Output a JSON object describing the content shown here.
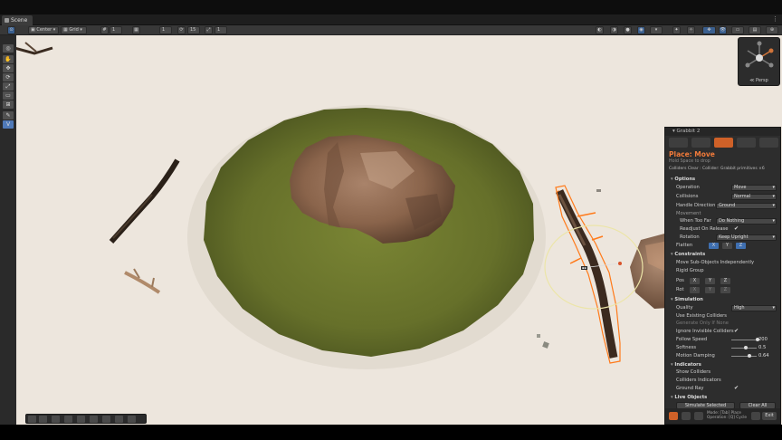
{
  "tab": {
    "label": "Scene"
  },
  "toolbar": {
    "pivot_label": "Center",
    "space_label": "Grid",
    "snap1": "1",
    "snap2": "1",
    "snap3": "15",
    "snap4": "1"
  },
  "gizmo": {
    "label": "≪ Persp"
  },
  "panel": {
    "header": "Grabbit 2",
    "title": "Place: Move",
    "subtitle": "Hold Space to drop",
    "info": "Colliders Clear : Collider: Grabbit primitives ×6",
    "sections": {
      "options": "Options",
      "constraints": "Constraints",
      "simulation": "Simulation",
      "indicators": "Indicators",
      "live_objects": "Live Objects"
    },
    "operation": {
      "label": "Operation",
      "value": "Move"
    },
    "collisions": {
      "label": "Collisions",
      "value": "Normal"
    },
    "handle_direction": {
      "label": "Handle Direction",
      "value": "Ground"
    },
    "movement_label": "Movement",
    "when_too_far": {
      "label": "When Too Far",
      "value": "Do Nothing"
    },
    "readjust": {
      "label": "Readjust On Release",
      "check": "✔"
    },
    "rotation": {
      "label": "Rotation",
      "value": "Keep Upright"
    },
    "flatten": {
      "label": "Flatten",
      "x": "X",
      "y": "Y",
      "z": "Z"
    },
    "move_sub": "Move Sub-Objects Independently",
    "rigid_group": "Rigid Group",
    "pos": {
      "label": "Pos",
      "x": "X",
      "y": "Y",
      "z": "Z"
    },
    "rot": {
      "label": "Rot",
      "x": "X",
      "y": "Y",
      "z": "Z"
    },
    "quality": {
      "label": "Quality",
      "value": "High"
    },
    "use_existing": "Use Existing Colliders",
    "generate_only": "Generate Only If None",
    "ignore_invisible": {
      "label": "Ignore Invisible Colliders",
      "check": "✔"
    },
    "follow_speed": {
      "label": "Follow Speed",
      "value": "200",
      "level": 0.95
    },
    "softness": {
      "label": "Softness",
      "value": "0.5",
      "level": 0.5
    },
    "motion_damping": {
      "label": "Motion Damping",
      "value": "0.64",
      "level": 0.64
    },
    "show_colliders": "Show Colliders",
    "colliders_indicators": "Colliders Indicators",
    "ground_ray": {
      "label": "Ground Ray",
      "check": "✔"
    },
    "simulate_selected": "Simulate Selected",
    "clear_all": "Clear All",
    "footer_mode": "Mode: [Tab] Place",
    "footer_op": "Operation: [Q] Cycle",
    "exit": "Exit"
  },
  "colors": {
    "accent": "#cf6128",
    "title": "#f07a3a",
    "viewport_bg": "#ede6dd",
    "grass": "#6f7a2e"
  }
}
